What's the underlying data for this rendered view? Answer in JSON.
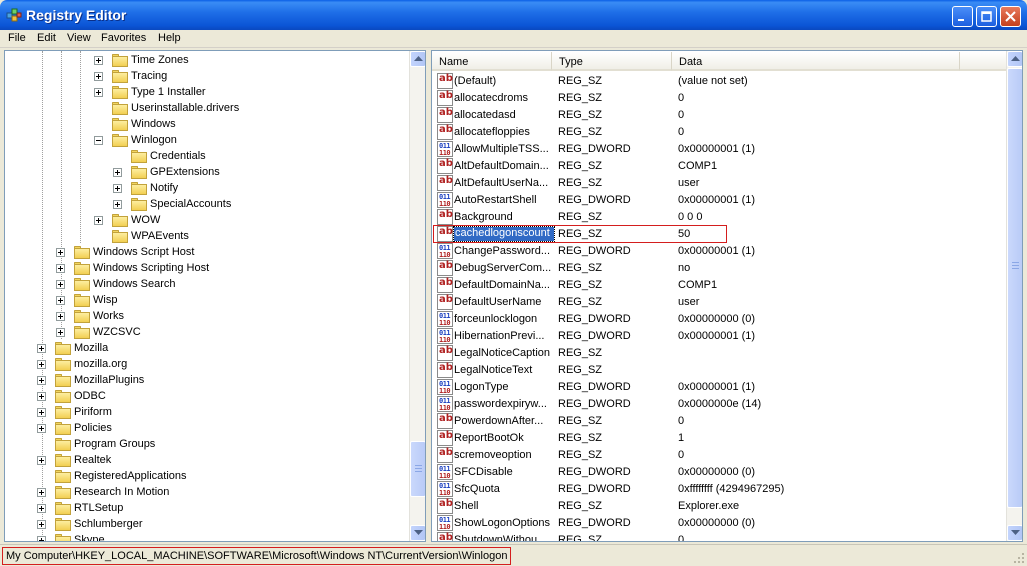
{
  "window": {
    "title": "Registry Editor"
  },
  "menu": [
    "File",
    "Edit",
    "View",
    "Favorites",
    "Help"
  ],
  "tree": [
    {
      "label": "Time Zones",
      "indent": 5,
      "expander": "plus"
    },
    {
      "label": "Tracing",
      "indent": 5,
      "expander": "plus"
    },
    {
      "label": "Type 1 Installer",
      "indent": 5,
      "expander": "plus"
    },
    {
      "label": "Userinstallable.drivers",
      "indent": 5,
      "expander": ""
    },
    {
      "label": "Windows",
      "indent": 5,
      "expander": ""
    },
    {
      "label": "Winlogon",
      "indent": 5,
      "expander": "minus"
    },
    {
      "label": "Credentials",
      "indent": 6,
      "expander": ""
    },
    {
      "label": "GPExtensions",
      "indent": 6,
      "expander": "plus"
    },
    {
      "label": "Notify",
      "indent": 6,
      "expander": "plus"
    },
    {
      "label": "SpecialAccounts",
      "indent": 6,
      "expander": "plus"
    },
    {
      "label": "WOW",
      "indent": 5,
      "expander": "plus"
    },
    {
      "label": "WPAEvents",
      "indent": 5,
      "expander": ""
    },
    {
      "label": "Windows Script Host",
      "indent": 3,
      "expander": "plus"
    },
    {
      "label": "Windows Scripting Host",
      "indent": 3,
      "expander": "plus"
    },
    {
      "label": "Windows Search",
      "indent": 3,
      "expander": "plus"
    },
    {
      "label": "Wisp",
      "indent": 3,
      "expander": "plus"
    },
    {
      "label": "Works",
      "indent": 3,
      "expander": "plus"
    },
    {
      "label": "WZCSVC",
      "indent": 3,
      "expander": "plus"
    },
    {
      "label": "Mozilla",
      "indent": 2,
      "expander": "plus"
    },
    {
      "label": "mozilla.org",
      "indent": 2,
      "expander": "plus"
    },
    {
      "label": "MozillaPlugins",
      "indent": 2,
      "expander": "plus"
    },
    {
      "label": "ODBC",
      "indent": 2,
      "expander": "plus"
    },
    {
      "label": "Piriform",
      "indent": 2,
      "expander": "plus"
    },
    {
      "label": "Policies",
      "indent": 2,
      "expander": "plus"
    },
    {
      "label": "Program Groups",
      "indent": 2,
      "expander": ""
    },
    {
      "label": "Realtek",
      "indent": 2,
      "expander": "plus"
    },
    {
      "label": "RegisteredApplications",
      "indent": 2,
      "expander": ""
    },
    {
      "label": "Research In Motion",
      "indent": 2,
      "expander": "plus"
    },
    {
      "label": "RTLSetup",
      "indent": 2,
      "expander": "plus"
    },
    {
      "label": "Schlumberger",
      "indent": 2,
      "expander": "plus"
    },
    {
      "label": "Skype",
      "indent": 2,
      "expander": "plus"
    }
  ],
  "list": {
    "columns": [
      "Name",
      "Type",
      "Data"
    ],
    "rows": [
      {
        "name": "(Default)",
        "type": "REG_SZ",
        "data": "(value not set)"
      },
      {
        "name": "allocatecdroms",
        "type": "REG_SZ",
        "data": "0"
      },
      {
        "name": "allocatedasd",
        "type": "REG_SZ",
        "data": "0"
      },
      {
        "name": "allocatefloppies",
        "type": "REG_SZ",
        "data": "0"
      },
      {
        "name": "AllowMultipleTSS...",
        "type": "REG_DWORD",
        "data": "0x00000001 (1)"
      },
      {
        "name": "AltDefaultDomain...",
        "type": "REG_SZ",
        "data": "COMP1"
      },
      {
        "name": "AltDefaultUserNa...",
        "type": "REG_SZ",
        "data": "user"
      },
      {
        "name": "AutoRestartShell",
        "type": "REG_DWORD",
        "data": "0x00000001 (1)"
      },
      {
        "name": "Background",
        "type": "REG_SZ",
        "data": "0 0 0"
      },
      {
        "name": "cachedlogonscount",
        "type": "REG_SZ",
        "data": "50",
        "selected": true
      },
      {
        "name": "ChangePassword...",
        "type": "REG_DWORD",
        "data": "0x00000001 (1)"
      },
      {
        "name": "DebugServerCom...",
        "type": "REG_SZ",
        "data": "no"
      },
      {
        "name": "DefaultDomainNa...",
        "type": "REG_SZ",
        "data": "COMP1"
      },
      {
        "name": "DefaultUserName",
        "type": "REG_SZ",
        "data": "user"
      },
      {
        "name": "forceunlocklogon",
        "type": "REG_DWORD",
        "data": "0x00000000 (0)"
      },
      {
        "name": "HibernationPrevi...",
        "type": "REG_DWORD",
        "data": "0x00000001 (1)"
      },
      {
        "name": "LegalNoticeCaption",
        "type": "REG_SZ",
        "data": ""
      },
      {
        "name": "LegalNoticeText",
        "type": "REG_SZ",
        "data": ""
      },
      {
        "name": "LogonType",
        "type": "REG_DWORD",
        "data": "0x00000001 (1)"
      },
      {
        "name": "passwordexpiryw...",
        "type": "REG_DWORD",
        "data": "0x0000000e (14)"
      },
      {
        "name": "PowerdownAfter...",
        "type": "REG_SZ",
        "data": "0"
      },
      {
        "name": "ReportBootOk",
        "type": "REG_SZ",
        "data": "1"
      },
      {
        "name": "scremoveoption",
        "type": "REG_SZ",
        "data": "0"
      },
      {
        "name": "SFCDisable",
        "type": "REG_DWORD",
        "data": "0x00000000 (0)"
      },
      {
        "name": "SfcQuota",
        "type": "REG_DWORD",
        "data": "0xffffffff (4294967295)"
      },
      {
        "name": "Shell",
        "type": "REG_SZ",
        "data": "Explorer.exe"
      },
      {
        "name": "ShowLogonOptions",
        "type": "REG_DWORD",
        "data": "0x00000000 (0)"
      },
      {
        "name": "ShutdownWithou...",
        "type": "REG_SZ",
        "data": "0"
      }
    ]
  },
  "status": {
    "path": "My Computer\\HKEY_LOCAL_MACHINE\\SOFTWARE\\Microsoft\\Windows NT\\CurrentVersion\\Winlogon"
  },
  "colors": {
    "selection": "#316ac5",
    "highlight": "#d41e1e",
    "titlebar": "#0b55d6"
  }
}
